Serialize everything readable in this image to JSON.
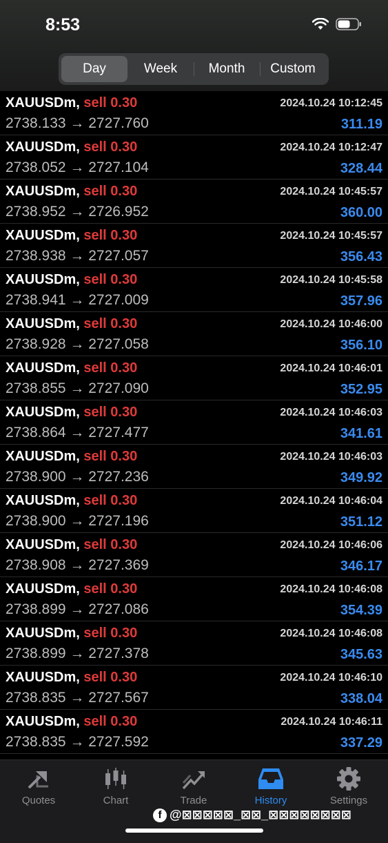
{
  "status": {
    "time": "8:53"
  },
  "segments": [
    {
      "label": "Day",
      "active": true
    },
    {
      "label": "Week",
      "active": false
    },
    {
      "label": "Month",
      "active": false
    },
    {
      "label": "Custom",
      "active": false
    }
  ],
  "trades": [
    {
      "symbol": "XAUUSDm,",
      "side": "sell",
      "volume": "0.30",
      "prices": "2738.133 → 2727.760",
      "time": "2024.10.24 10:12:45",
      "profit": "311.19"
    },
    {
      "symbol": "XAUUSDm,",
      "side": "sell",
      "volume": "0.30",
      "prices": "2738.052 → 2727.104",
      "time": "2024.10.24 10:12:47",
      "profit": "328.44"
    },
    {
      "symbol": "XAUUSDm,",
      "side": "sell",
      "volume": "0.30",
      "prices": "2738.952 → 2726.952",
      "time": "2024.10.24 10:45:57",
      "profit": "360.00"
    },
    {
      "symbol": "XAUUSDm,",
      "side": "sell",
      "volume": "0.30",
      "prices": "2738.938 → 2727.057",
      "time": "2024.10.24 10:45:57",
      "profit": "356.43"
    },
    {
      "symbol": "XAUUSDm,",
      "side": "sell",
      "volume": "0.30",
      "prices": "2738.941 → 2727.009",
      "time": "2024.10.24 10:45:58",
      "profit": "357.96"
    },
    {
      "symbol": "XAUUSDm,",
      "side": "sell",
      "volume": "0.30",
      "prices": "2738.928 → 2727.058",
      "time": "2024.10.24 10:46:00",
      "profit": "356.10"
    },
    {
      "symbol": "XAUUSDm,",
      "side": "sell",
      "volume": "0.30",
      "prices": "2738.855 → 2727.090",
      "time": "2024.10.24 10:46:01",
      "profit": "352.95"
    },
    {
      "symbol": "XAUUSDm,",
      "side": "sell",
      "volume": "0.30",
      "prices": "2738.864 → 2727.477",
      "time": "2024.10.24 10:46:03",
      "profit": "341.61"
    },
    {
      "symbol": "XAUUSDm,",
      "side": "sell",
      "volume": "0.30",
      "prices": "2738.900 → 2727.236",
      "time": "2024.10.24 10:46:03",
      "profit": "349.92"
    },
    {
      "symbol": "XAUUSDm,",
      "side": "sell",
      "volume": "0.30",
      "prices": "2738.900 → 2727.196",
      "time": "2024.10.24 10:46:04",
      "profit": "351.12"
    },
    {
      "symbol": "XAUUSDm,",
      "side": "sell",
      "volume": "0.30",
      "prices": "2738.908 → 2727.369",
      "time": "2024.10.24 10:46:06",
      "profit": "346.17"
    },
    {
      "symbol": "XAUUSDm,",
      "side": "sell",
      "volume": "0.30",
      "prices": "2738.899 → 2727.086",
      "time": "2024.10.24 10:46:08",
      "profit": "354.39"
    },
    {
      "symbol": "XAUUSDm,",
      "side": "sell",
      "volume": "0.30",
      "prices": "2738.899 → 2727.378",
      "time": "2024.10.24 10:46:08",
      "profit": "345.63"
    },
    {
      "symbol": "XAUUSDm,",
      "side": "sell",
      "volume": "0.30",
      "prices": "2738.835 → 2727.567",
      "time": "2024.10.24 10:46:10",
      "profit": "338.04"
    },
    {
      "symbol": "XAUUSDm,",
      "side": "sell",
      "volume": "0.30",
      "prices": "2738.835 → 2727.592",
      "time": "2024.10.24 10:46:11",
      "profit": "337.29"
    }
  ],
  "tabs": [
    {
      "label": "Quotes",
      "icon": "quotes-icon"
    },
    {
      "label": "Chart",
      "icon": "chart-icon"
    },
    {
      "label": "Trade",
      "icon": "trade-icon"
    },
    {
      "label": "History",
      "icon": "history-icon",
      "active": true
    },
    {
      "label": "Settings",
      "icon": "settings-icon"
    }
  ],
  "watermark": "@⊠⊠⊠⊠⊠_⊠⊠_⊠⊠⊠⊠⊠⊠⊠⊠",
  "colors": {
    "sell": "#e03a3a",
    "profit": "#3a8bf0",
    "active_tab": "#2f8cf1"
  }
}
